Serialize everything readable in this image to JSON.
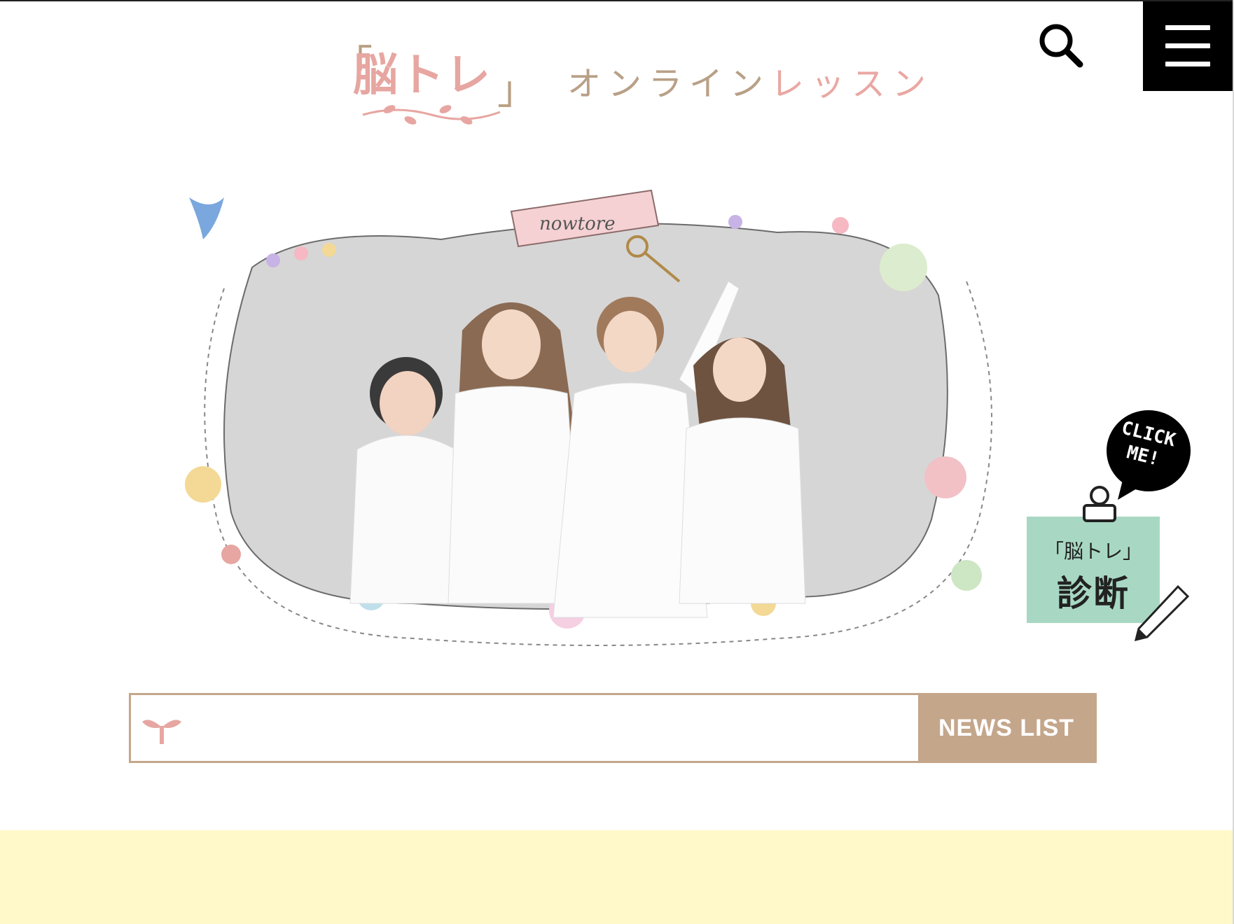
{
  "header": {
    "logo_mark": "脳トレ",
    "logo_open_bracket": "「",
    "logo_close_bracket": "」",
    "logo_sub_part1": "オンライン",
    "logo_sub_part2": "レッスン",
    "search_icon": "search-icon",
    "menu_icon": "hamburger-icon"
  },
  "hero": {
    "banner_text": "nowtore",
    "image_alt": "four women in white dresses inside an illustrated floral frame"
  },
  "diagnosis": {
    "bubble_text_line1": "CLICK",
    "bubble_text_line2": "ME!",
    "card_line1": "「脳トレ」",
    "card_line2": "診断"
  },
  "news": {
    "input_value": "",
    "icon": "sprout-icon",
    "button_label": "NEWS LIST"
  },
  "colors": {
    "accent_pink": "#e7a6a1",
    "accent_tan": "#c4a68b",
    "mint": "#a8d8c3",
    "band_yellow": "#fff9c9"
  }
}
